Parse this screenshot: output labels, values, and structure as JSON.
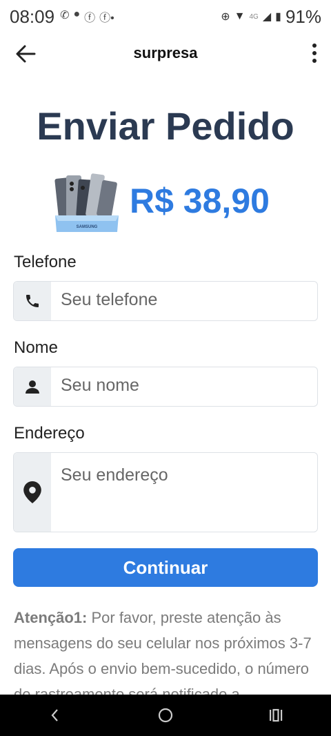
{
  "status_bar": {
    "time": "08:09",
    "battery": "91%",
    "network": "4G",
    "icons": [
      "whatsapp-icon",
      "chat-icon",
      "facebook-icon",
      "facebook-icon"
    ]
  },
  "app_bar": {
    "title": "surpresa"
  },
  "page": {
    "heading": "Enviar Pedido",
    "price": "R$ 38,90",
    "product_brand": "SAMSUNG"
  },
  "form": {
    "phone": {
      "label": "Telefone",
      "placeholder": "Seu telefone"
    },
    "name": {
      "label": "Nome",
      "placeholder": "Seu nome"
    },
    "address": {
      "label": "Endereço",
      "placeholder": "Seu endereço"
    },
    "submit_label": "Continuar"
  },
  "notice": {
    "bold": "Atenção1:",
    "text": " Por favor, preste atenção às mensagens do seu celular nos próximos 3-7 dias. Após o envio bem-sucedido, o número de rastreamento será notificado a"
  },
  "colors": {
    "accent": "#2e7be0",
    "heading": "#2b3a52",
    "addon_bg": "#eceff2"
  }
}
